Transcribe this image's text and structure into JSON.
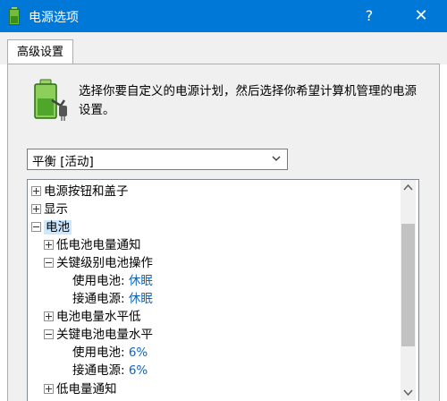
{
  "window": {
    "title": "电源选项",
    "help_glyph": "?",
    "close_glyph": "✕"
  },
  "tabs": [
    {
      "label": "高级设置",
      "selected": true
    }
  ],
  "description": "选择你要自定义的电源计划，然后选择你希望计算机管理的电源设置。",
  "plan_select": {
    "value": "平衡 [活动]"
  },
  "tree": {
    "items": [
      {
        "label": "电源按钮和盖子",
        "level": 0,
        "expander": "plus"
      },
      {
        "label": "显示",
        "level": 0,
        "expander": "plus"
      },
      {
        "label": "电池",
        "level": 0,
        "expander": "minus",
        "selected": true
      },
      {
        "label": "低电池电量通知",
        "level": 1,
        "expander": "plus"
      },
      {
        "label": "关键级别电池操作",
        "level": 1,
        "expander": "minus"
      },
      {
        "label": "使用电池: ",
        "value": "休眠",
        "level": 2
      },
      {
        "label": "接通电源: ",
        "value": "休眠",
        "level": 2
      },
      {
        "label": "电池电量水平低",
        "level": 1,
        "expander": "plus"
      },
      {
        "label": "关键电池电量水平",
        "level": 1,
        "expander": "minus"
      },
      {
        "label": "使用电池: ",
        "value": "6%",
        "level": 2
      },
      {
        "label": "接通电源: ",
        "value": "6%",
        "level": 2
      },
      {
        "label": "低电量通知",
        "level": 1,
        "expander": "plus"
      }
    ]
  },
  "colors": {
    "titlebar": "#0078d7",
    "value_text": "#1464b4",
    "selection": "#cce8ff"
  },
  "icons": {
    "app": "battery-plug-icon",
    "header": "battery-plug-icon"
  }
}
